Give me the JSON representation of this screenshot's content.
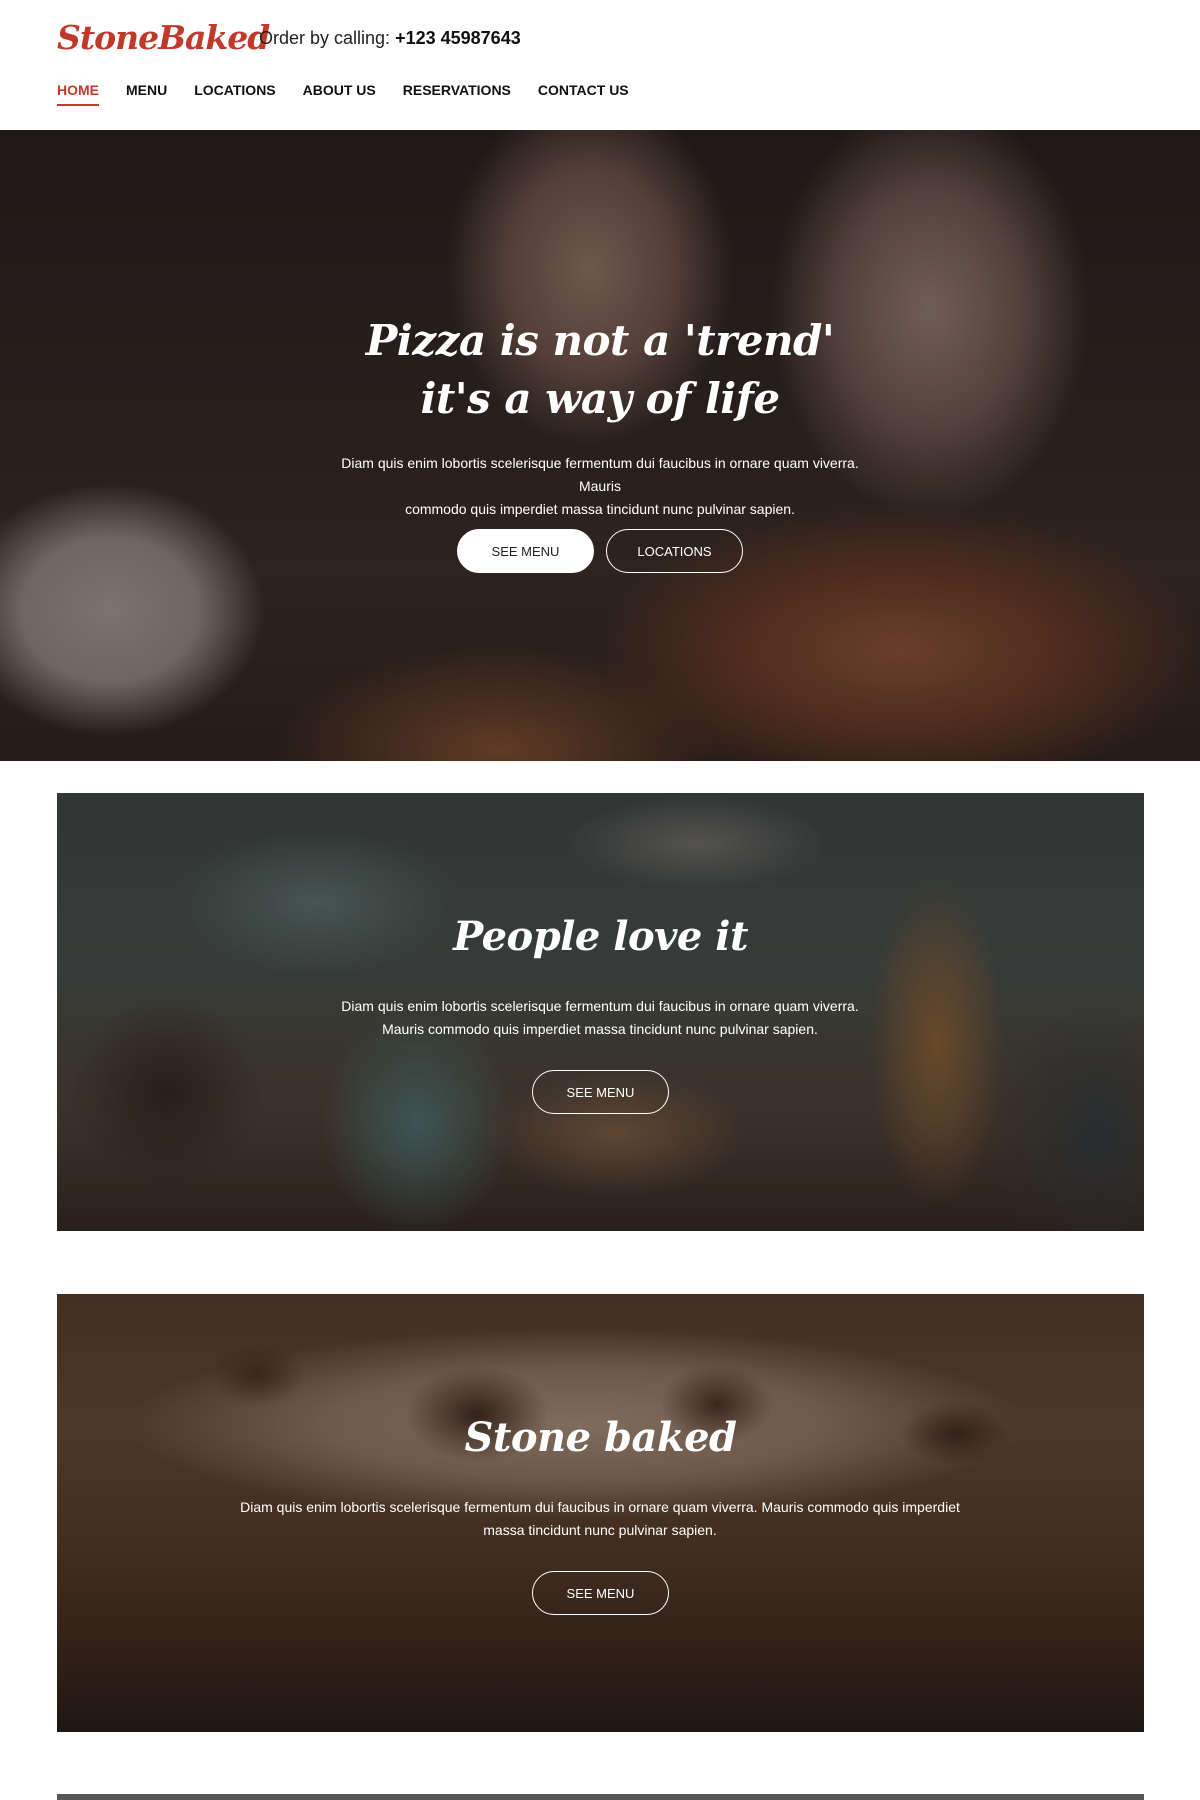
{
  "header": {
    "logo": "StoneBaked",
    "order_label": "Order by calling:",
    "phone": "+123 45987643",
    "nav": [
      {
        "label": "HOME",
        "active": true
      },
      {
        "label": "MENU",
        "active": false
      },
      {
        "label": "LOCATIONS",
        "active": false
      },
      {
        "label": "ABOUT US",
        "active": false
      },
      {
        "label": "RESERVATIONS",
        "active": false
      },
      {
        "label": "CONTACT US",
        "active": false
      }
    ]
  },
  "hero": {
    "title_line1": "Pizza is not a 'trend'",
    "title_line2": "it's a way of life",
    "text_line1": "Diam quis enim lobortis scelerisque fermentum dui faucibus in ornare quam viverra. Mauris",
    "text_line2": "commodo quis imperdiet massa tincidunt nunc pulvinar sapien.",
    "primary_button": "SEE MENU",
    "secondary_button": "LOCATIONS"
  },
  "sections": [
    {
      "title": "People love it",
      "text_line1": "Diam quis enim lobortis scelerisque fermentum dui faucibus in ornare quam viverra.",
      "text_line2": "Mauris commodo quis imperdiet massa tincidunt nunc pulvinar sapien.",
      "button": "SEE MENU"
    },
    {
      "title": "Stone baked",
      "text_line1": "Diam quis enim lobortis scelerisque fermentum dui faucibus in ornare quam viverra. Mauris commodo quis imperdiet",
      "text_line2": "massa tincidunt nunc pulvinar sapien.",
      "button": "SEE MENU"
    }
  ],
  "colors": {
    "brand": "#c0392b",
    "text": "#111111",
    "background": "#ffffff",
    "overlay": "#140f0f"
  }
}
